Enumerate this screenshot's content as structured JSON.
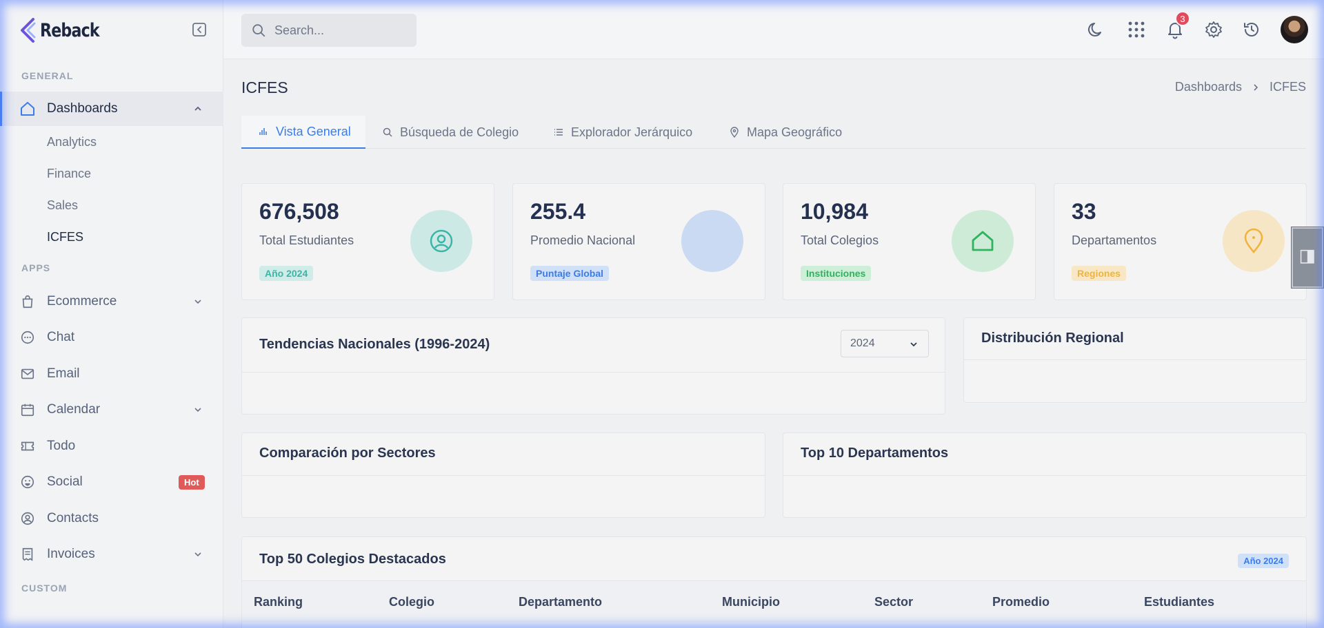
{
  "brand": {
    "name": "Reback"
  },
  "sidebar": {
    "sections": {
      "general": "GENERAL",
      "apps": "APPS",
      "custom": "CUSTOM"
    },
    "dashboards": {
      "label": "Dashboards",
      "children": [
        "Analytics",
        "Finance",
        "Sales",
        "ICFES"
      ]
    },
    "apps": [
      {
        "label": "Ecommerce",
        "icon": "shopping-bag-icon"
      },
      {
        "label": "Chat",
        "icon": "chat-icon"
      },
      {
        "label": "Email",
        "icon": "mail-icon"
      },
      {
        "label": "Calendar",
        "icon": "calendar-icon"
      },
      {
        "label": "Todo",
        "icon": "ticket-icon"
      },
      {
        "label": "Social",
        "icon": "smile-icon",
        "badge": "Hot"
      },
      {
        "label": "Contacts",
        "icon": "user-circle-icon"
      },
      {
        "label": "Invoices",
        "icon": "receipt-icon"
      }
    ]
  },
  "topbar": {
    "search_placeholder": "Search...",
    "notifications_count": "3"
  },
  "page": {
    "title": "ICFES",
    "breadcrumb": [
      "Dashboards",
      "ICFES"
    ]
  },
  "tabs": [
    "Vista General",
    "Búsqueda de Colegio",
    "Explorador Jerárquico",
    "Mapa Geográfico"
  ],
  "stats": [
    {
      "value": "676,508",
      "label": "Total Estudiantes",
      "badge": "Año 2024",
      "color": "#3bb5a6",
      "badge_bg": "#cfece8",
      "circle_bg": "#cde9e6"
    },
    {
      "value": "255.4",
      "label": "Promedio Nacional",
      "badge": "Puntaje Global",
      "color": "#3c7ce8",
      "badge_bg": "#cfe0f7",
      "circle_bg": "#c9daf2"
    },
    {
      "value": "10,984",
      "label": "Total Colegios",
      "badge": "Instituciones",
      "color": "#2fb35c",
      "badge_bg": "#cdeed7",
      "circle_bg": "#cdebd6"
    },
    {
      "value": "33",
      "label": "Departamentos",
      "badge": "Regiones",
      "color": "#f0b43c",
      "badge_bg": "#f8e7c4",
      "circle_bg": "#f6e6c6"
    }
  ],
  "panels": {
    "tendencias": {
      "title": "Tendencias Nacionales (1996-2024)",
      "select_value": "2024"
    },
    "distribucion": {
      "title": "Distribución Regional"
    },
    "comparacion": {
      "title": "Comparación por Sectores"
    },
    "top10": {
      "title": "Top 10 Departamentos"
    },
    "top50": {
      "title": "Top 50 Colegios Destacados",
      "badge": "Año 2024",
      "columns": [
        "Ranking",
        "Colegio",
        "Departamento",
        "Municipio",
        "Sector",
        "Promedio",
        "Estudiantes"
      ]
    }
  }
}
